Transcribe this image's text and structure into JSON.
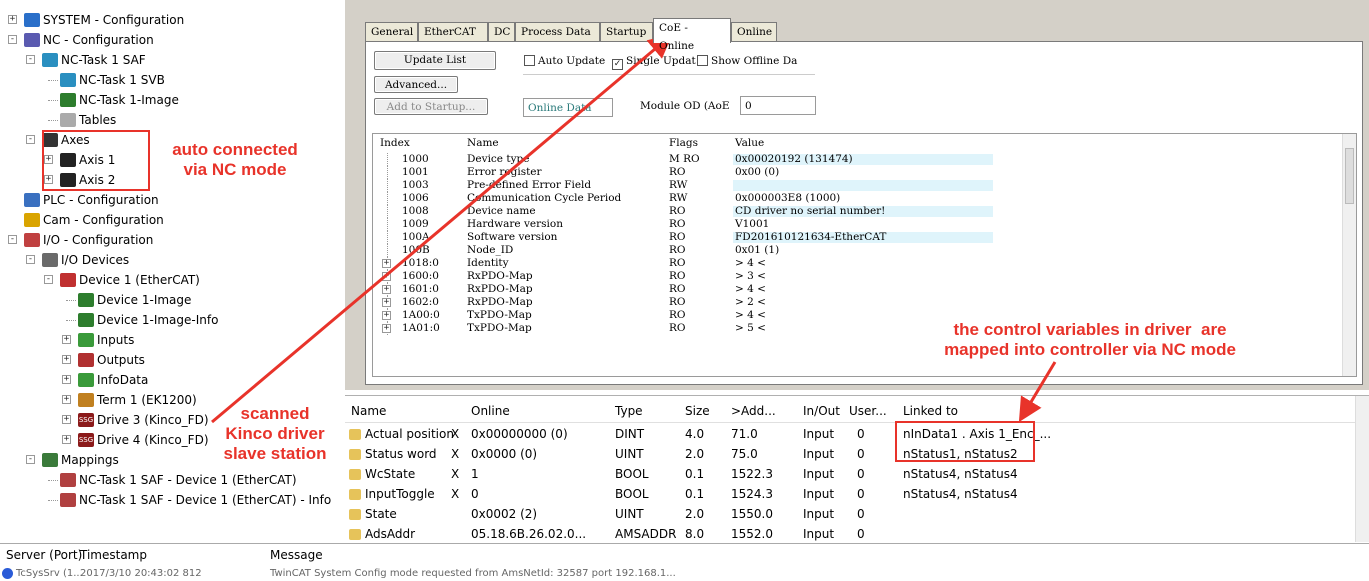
{
  "tree": {
    "items": [
      {
        "label": "SYSTEM - Configuration",
        "expander": "+"
      },
      {
        "label": "NC - Configuration",
        "expander": "-"
      },
      {
        "label": "NC-Task 1 SAF",
        "expander": "-"
      },
      {
        "label": "NC-Task 1 SVB"
      },
      {
        "label": "NC-Task 1-Image"
      },
      {
        "label": "Tables"
      },
      {
        "label": "Axes",
        "expander": "-"
      },
      {
        "label": "Axis 1",
        "expander": "+"
      },
      {
        "label": "Axis 2",
        "expander": "+"
      },
      {
        "label": "PLC - Configuration"
      },
      {
        "label": "Cam - Configuration"
      },
      {
        "label": "I/O - Configuration",
        "expander": "-"
      },
      {
        "label": "I/O Devices",
        "expander": "-"
      },
      {
        "label": "Device 1 (EtherCAT)",
        "expander": "-"
      },
      {
        "label": "Device 1-Image"
      },
      {
        "label": "Device 1-Image-Info"
      },
      {
        "label": "Inputs",
        "expander": "+"
      },
      {
        "label": "Outputs",
        "expander": "+"
      },
      {
        "label": "InfoData",
        "expander": "+"
      },
      {
        "label": "Term 1 (EK1200)",
        "expander": "+"
      },
      {
        "label": "Drive 3 (Kinco_FD)",
        "expander": "+"
      },
      {
        "label": "Drive 4 (Kinco_FD)",
        "expander": "+"
      },
      {
        "label": "Mappings",
        "expander": "-"
      },
      {
        "label": "NC-Task 1 SAF - Device 1 (EtherCAT)"
      },
      {
        "label": "NC-Task 1 SAF - Device 1 (EtherCAT) - Info"
      }
    ]
  },
  "tabs": [
    "General",
    "EtherCAT",
    "DC",
    "Process Data",
    "Startup",
    "CoE - Online",
    "Online"
  ],
  "active_tab": "CoE - Online",
  "controls": {
    "update_list": "Update List",
    "advanced": "Advanced...",
    "add_to_startup": "Add to Startup...",
    "auto_update": "Auto Update",
    "single_update": "Single Updat",
    "show_offline": "Show Offline Da",
    "online_data": "Online Data",
    "module_od_label": "Module OD (AoE",
    "module_od_value": "0"
  },
  "coe": {
    "headers": [
      "Index",
      "Name",
      "Flags",
      "Value"
    ],
    "rows": [
      {
        "exp": "",
        "index": "1000",
        "name": "Device type",
        "flags": "M RO",
        "value": "0x00020192 (131474)"
      },
      {
        "exp": "",
        "index": "1001",
        "name": "Error register",
        "flags": "RO",
        "value": "0x00 (0)"
      },
      {
        "exp": "",
        "index": "1003",
        "name": "Pre-defined Error Field",
        "flags": "RW",
        "value": ""
      },
      {
        "exp": "",
        "index": "1006",
        "name": "Communication Cycle Period",
        "flags": "RW",
        "value": "0x000003E8 (1000)"
      },
      {
        "exp": "",
        "index": "1008",
        "name": "Device name",
        "flags": "RO",
        "value": "CD driver no serial number!"
      },
      {
        "exp": "",
        "index": "1009",
        "name": "Hardware version",
        "flags": "RO",
        "value": "V1001"
      },
      {
        "exp": "",
        "index": "100A",
        "name": "Software version",
        "flags": "RO",
        "value": "FD201610121634-EtherCAT"
      },
      {
        "exp": "",
        "index": "100B",
        "name": "Node_ID",
        "flags": "RO",
        "value": "0x01 (1)"
      },
      {
        "exp": "+",
        "index": "1018:0",
        "name": "Identity",
        "flags": "RO",
        "value": "> 4 <"
      },
      {
        "exp": "+",
        "index": "1600:0",
        "name": "RxPDO-Map",
        "flags": "RO",
        "value": "> 3 <"
      },
      {
        "exp": "+",
        "index": "1601:0",
        "name": "RxPDO-Map",
        "flags": "RO",
        "value": "> 4 <"
      },
      {
        "exp": "+",
        "index": "1602:0",
        "name": "RxPDO-Map",
        "flags": "RO",
        "value": "> 2 <"
      },
      {
        "exp": "+",
        "index": "1A00:0",
        "name": "TxPDO-Map",
        "flags": "RO",
        "value": "> 4 <"
      },
      {
        "exp": "+",
        "index": "1A01:0",
        "name": "TxPDO-Map",
        "flags": "RO",
        "value": "> 5 <"
      }
    ]
  },
  "vars": {
    "headers": [
      "Name",
      "Online",
      "Type",
      "Size",
      ">Add...",
      "In/Out",
      "User...",
      "Linked to"
    ],
    "rows": [
      {
        "name": "Actual position",
        "x": "X",
        "online": "0x00000000 (0)",
        "type": "DINT",
        "size": "4.0",
        "addr": "71.0",
        "inout": "Input",
        "user": "0",
        "linked": "nInData1 . Axis 1_Enc_..."
      },
      {
        "name": "Status word",
        "x": "X",
        "online": "0x0000 (0)",
        "type": "UINT",
        "size": "2.0",
        "addr": "75.0",
        "inout": "Input",
        "user": "0",
        "linked": "nStatus1, nStatus2"
      },
      {
        "name": "WcState",
        "x": "X",
        "online": "1",
        "type": "BOOL",
        "size": "0.1",
        "addr": "1522.3",
        "inout": "Input",
        "user": "0",
        "linked": "nStatus4, nStatus4"
      },
      {
        "name": "InputToggle",
        "x": "X",
        "online": "0",
        "type": "BOOL",
        "size": "0.1",
        "addr": "1524.3",
        "inout": "Input",
        "user": "0",
        "linked": "nStatus4, nStatus4"
      },
      {
        "name": "State",
        "x": "",
        "online": "0x0002 (2)",
        "type": "UINT",
        "size": "2.0",
        "addr": "1550.0",
        "inout": "Input",
        "user": "0",
        "linked": ""
      },
      {
        "name": "AdsAddr",
        "x": "",
        "online": "05.18.6B.26.02.0...",
        "type": "AMSADDR",
        "size": "8.0",
        "addr": "1552.0",
        "inout": "Input",
        "user": "0",
        "linked": ""
      }
    ]
  },
  "status": {
    "headers": [
      "Server (Port)",
      "Timestamp",
      "Message"
    ],
    "row": {
      "server": "TcSysSrv (1...",
      "timestamp": "2017/3/10 20:43:02 812",
      "message": "TwinCAT System Config mode requested from AmsNetId: 32587 port 192.168.1..."
    }
  },
  "annotations": {
    "auto_connected": "auto connected\nvia NC mode",
    "scanned": "scanned\nKinco driver\nslave station",
    "control_vars": "the control variables in driver  are\nmapped into controller via NC mode"
  },
  "colors": {
    "annotation": "#e8332a",
    "selected_tab": "#ffffff",
    "row_highlight": "#dff4fb"
  }
}
